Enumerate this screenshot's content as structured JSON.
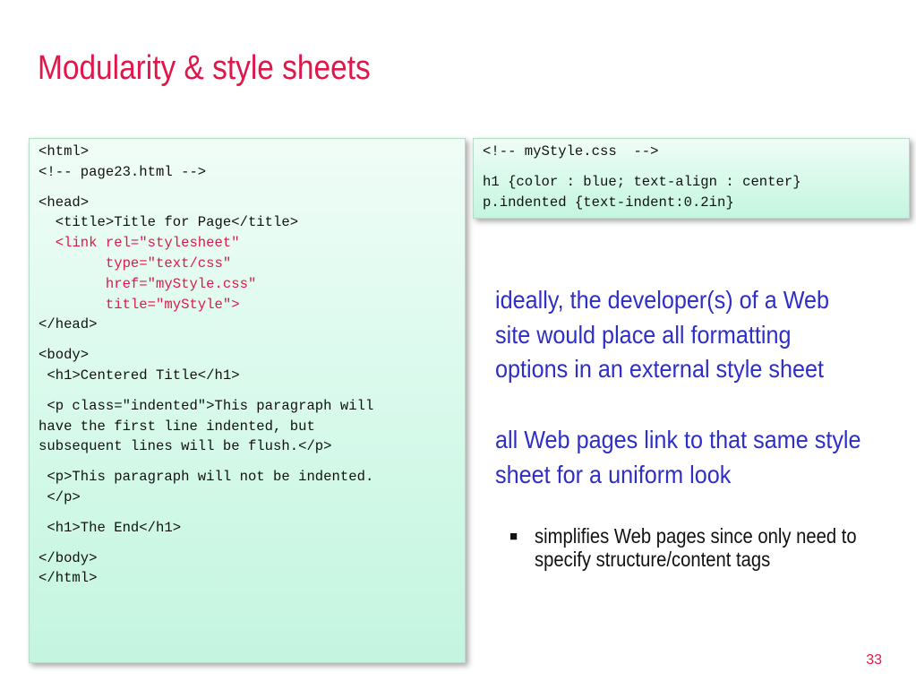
{
  "slide": {
    "title": "Modularity & style sheets",
    "page_number": "33"
  },
  "html_code": {
    "l1": "<html>",
    "l2": "<!-- page23.html -->",
    "l3": "<head>",
    "l4": "  <title>Title for Page</title>",
    "l5": "  <link rel=\"stylesheet\"",
    "l6": "        type=\"text/css\"",
    "l7": "        href=\"myStyle.css\"",
    "l8": "        title=\"myStyle\">",
    "l9": "</head>",
    "l10": "<body>",
    "l11": " <h1>Centered Title</h1>",
    "l12": " <p class=\"indented\">This paragraph will",
    "l13": "have the first line indented, but",
    "l14": "subsequent lines will be flush.</p>",
    "l15": " <p>This paragraph will not be indented.",
    "l16": " </p>",
    "l17": " <h1>The End</h1>",
    "l18": "</body>",
    "l19": "</html>"
  },
  "css_code": {
    "l1": "<!-- myStyle.css  -->",
    "l2": "h1 {color : blue; text-align : center}",
    "l3": "p.indented {text-indent:0.2in}"
  },
  "text": {
    "para1": "ideally, the developer(s) of a Web site would place all formatting options in an external style sheet",
    "para2": "all Web pages link to that same style sheet for a uniform look",
    "bullet1": "simplifies Web pages since only need to specify structure/content tags"
  },
  "colors": {
    "title": "#e0174a",
    "highlight_code": "#e0174a",
    "prose": "#2e2ec8",
    "code_box_top": "#f0fdf7",
    "code_box_bottom": "#c4f5e0"
  }
}
